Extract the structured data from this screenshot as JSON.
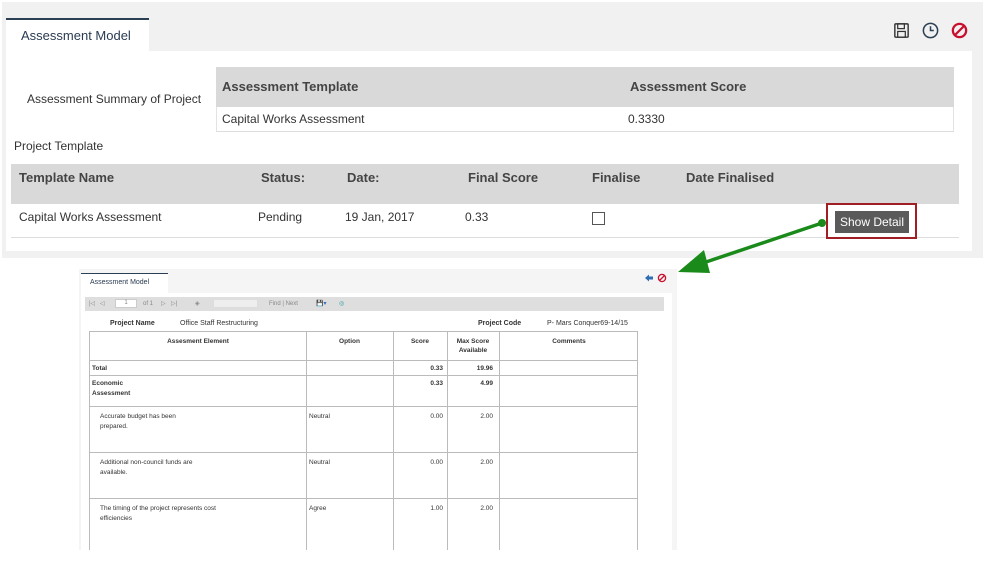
{
  "header": {
    "tab_label": "Assessment Model"
  },
  "icons": {
    "save": "save-icon",
    "history": "history-icon",
    "cancel": "cancel-icon"
  },
  "colors": {
    "accent": "#2b3f55",
    "cancel": "#c8102e",
    "highlight_border": "#a11f24",
    "arrow": "#1a8a1a"
  },
  "summary": {
    "label": "Assessment Summary of Project",
    "columns": [
      "Assessment Template",
      "Assessment Score"
    ],
    "rows": [
      {
        "template": "Capital Works Assessment",
        "score": "0.3330"
      }
    ]
  },
  "project_template": {
    "label": "Project Template",
    "columns": [
      "Template Name",
      "Status:",
      "Date:",
      "Final Score",
      "Finalise",
      "Date Finalised"
    ],
    "rows": [
      {
        "name": "Capital Works Assessment",
        "status": "Pending",
        "date": "19 Jan, 2017",
        "final_score": "0.33",
        "date_finalised": "",
        "action_label": "Show Detail"
      }
    ]
  },
  "report": {
    "tab_label": "Assessment Model",
    "toolbar": {
      "page_input": "1",
      "of_label": "of 1",
      "find_next": "Find | Next"
    },
    "project_name_label": "Project Name",
    "project_name": "Office Staff Restructuring",
    "project_code_label": "Project Code",
    "project_code": "P- Mars Conquer69-14/15",
    "columns": {
      "element": "Assesment Element",
      "option": "Option",
      "score": "Score",
      "max_score_1": "Max Score",
      "max_score_2": "Available",
      "comments": "Comments"
    },
    "total": {
      "label": "Total",
      "score": "0.33",
      "max": "19.96"
    },
    "section": {
      "label_1": "Economic",
      "label_2": "Assessment",
      "score": "0.33",
      "max": "4.99"
    },
    "rows": [
      {
        "line1": "Accurate budget has been",
        "line2": "prepared.",
        "option": "Neutral",
        "score": "0.00",
        "max": "2.00"
      },
      {
        "line1": "Additional non-council funds are",
        "line2": "available.",
        "option": "Neutral",
        "score": "0.00",
        "max": "2.00"
      },
      {
        "line1": "The timing of the project represents cost",
        "line2": "efficiencies",
        "option": "Agree",
        "score": "1.00",
        "max": "2.00"
      }
    ]
  }
}
